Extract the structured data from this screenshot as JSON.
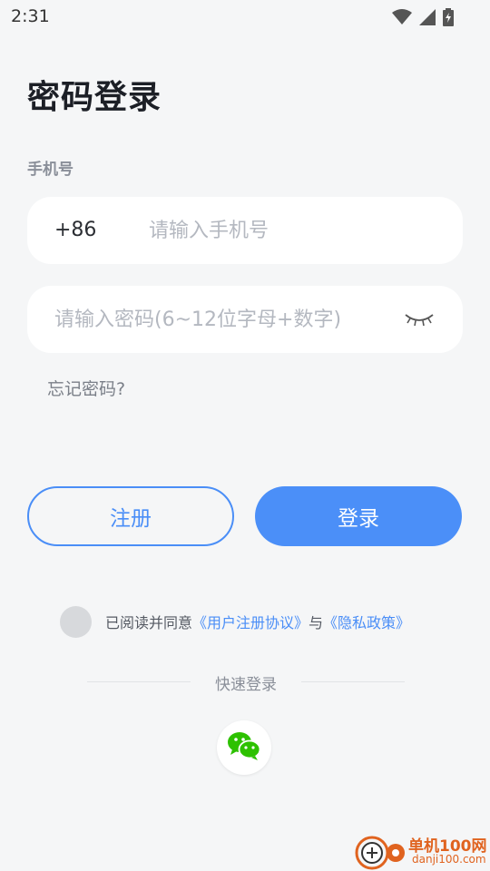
{
  "status_bar": {
    "time": "2:31",
    "icons": [
      "wifi-icon",
      "signal-icon",
      "battery-charging-icon"
    ]
  },
  "title": "密码登录",
  "phone_label": "手机号",
  "phone_field": {
    "country_code": "+86",
    "value": "",
    "placeholder": "请输入手机号"
  },
  "password_field": {
    "value": "",
    "placeholder": "请输入密码(6~12位字母+数字)",
    "toggle_icon": "eye-closed-icon"
  },
  "forgot_password": "忘记密码?",
  "buttons": {
    "register": "注册",
    "login": "登录"
  },
  "agreement": {
    "prefix": "已阅读并同意",
    "user_agreement": "《用户注册协议》",
    "conjunction": "与",
    "privacy_policy": "《隐私政策》"
  },
  "quick_login": {
    "label": "快速登录",
    "options": [
      "wechat-icon"
    ]
  },
  "watermark": {
    "brand": "单机100网",
    "domain": "danji100.com"
  },
  "colors": {
    "accent": "#4b8ff8",
    "background": "#f5f6f7",
    "watermark": "#e0631f",
    "wechat": "#2dc100"
  }
}
